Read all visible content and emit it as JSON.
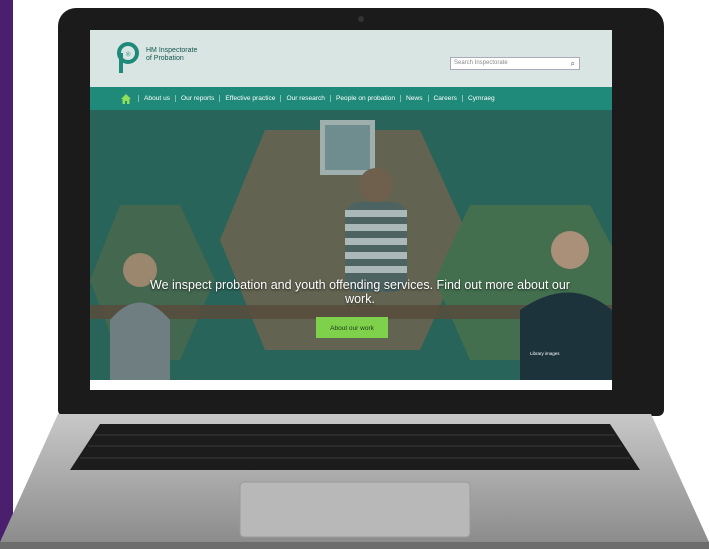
{
  "site": {
    "logo_line1": "HM Inspectorate",
    "logo_line2": "of Probation",
    "search_placeholder": "Search Inspectorate"
  },
  "nav": {
    "items": [
      "About us",
      "Our reports",
      "Effective practice",
      "Our research",
      "People on probation",
      "News",
      "Careers",
      "Cymraeg"
    ]
  },
  "hero": {
    "headline": "We inspect probation and youth offending services. Find out more about our work.",
    "button_label": "About our work",
    "credit": "Library images"
  },
  "colors": {
    "brand_teal": "#1f8a7a",
    "header_bg": "#d9e5e3",
    "button_green": "#7fd14b",
    "frame_purple": "#4a1f6e"
  },
  "icons": [
    "home-icon",
    "search-icon",
    "logo-icon"
  ]
}
